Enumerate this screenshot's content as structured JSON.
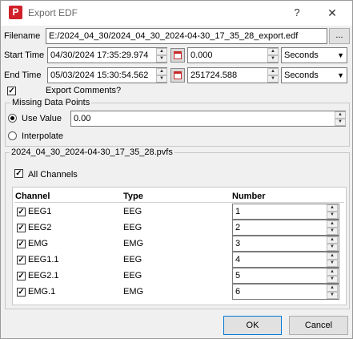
{
  "window": {
    "title": "Export EDF",
    "help": "?",
    "close": "✕",
    "app_icon": "P"
  },
  "filename": {
    "label": "Filename",
    "value": "E:/2024_04_30/2024_04_30_2024-04-30_17_35_28_export.edf",
    "browse": "..."
  },
  "start_time": {
    "label": "Start Time",
    "datetime": "04/30/2024 17:35:29.974",
    "value": "0.000",
    "unit": "Seconds"
  },
  "end_time": {
    "label": "End Time",
    "datetime": "05/03/2024 15:30:54.562",
    "value": "251724.588",
    "unit": "Seconds"
  },
  "export_comments": {
    "label": "Export Comments?",
    "checked": true
  },
  "missing": {
    "title": "Missing Data Points",
    "use_value_label": "Use Value",
    "use_value": "0.00",
    "interpolate_label": "Interpolate"
  },
  "file_group": {
    "title": "2024_04_30_2024-04-30_17_35_28.pvfs",
    "all_channels_label": "All Channels",
    "headers": {
      "channel": "Channel",
      "type": "Type",
      "number": "Number"
    },
    "rows": [
      {
        "channel": "EEG1",
        "type": "EEG",
        "number": "1"
      },
      {
        "channel": "EEG2",
        "type": "EEG",
        "number": "2"
      },
      {
        "channel": "EMG",
        "type": "EMG",
        "number": "3"
      },
      {
        "channel": "EEG1.1",
        "type": "EEG",
        "number": "4"
      },
      {
        "channel": "EEG2.1",
        "type": "EEG",
        "number": "5"
      },
      {
        "channel": "EMG.1",
        "type": "EMG",
        "number": "6"
      }
    ]
  },
  "buttons": {
    "ok": "OK",
    "cancel": "Cancel"
  },
  "glyphs": {
    "check": "✓",
    "up": "▲",
    "down": "▼",
    "dropdown": "▼"
  }
}
